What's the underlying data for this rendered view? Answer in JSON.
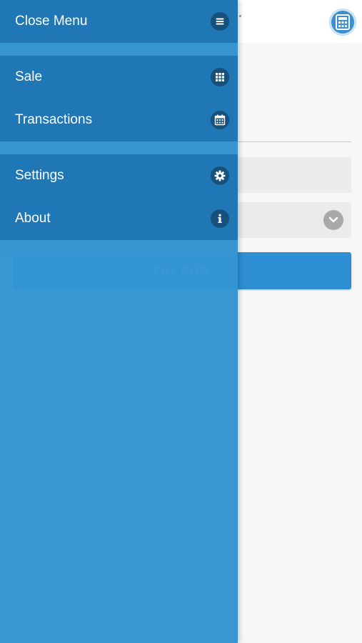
{
  "background": {
    "logo_icon": "calculator-icon",
    "pay_button_label": "PAY NOW",
    "select_icon": "chevron-down-icon"
  },
  "menu": {
    "close": {
      "label": "Close Menu",
      "icon": "hamburger-icon"
    },
    "items": [
      {
        "label": "Sale",
        "icon": "grid-icon"
      },
      {
        "label": "Transactions",
        "icon": "calendar-icon"
      },
      {
        "label": "Settings",
        "icon": "gear-icon"
      },
      {
        "label": "About",
        "icon": "info-icon"
      }
    ]
  },
  "colors": {
    "drawer_bg": "#3395d3",
    "menu_row_bg": "#1f77b5",
    "icon_circle": "#17507b",
    "accent_button": "#2d8ed4"
  }
}
